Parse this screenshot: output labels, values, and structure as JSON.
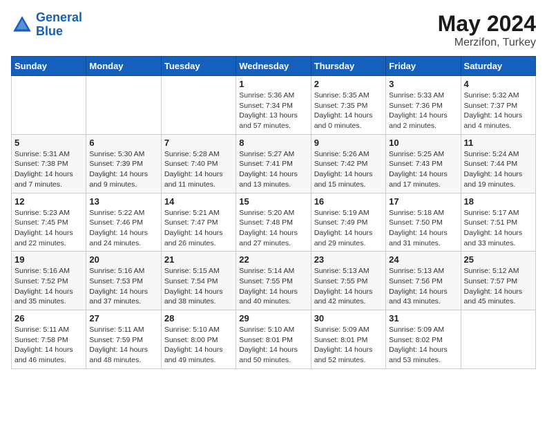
{
  "header": {
    "logo_line1": "General",
    "logo_line2": "Blue",
    "title": "May 2024",
    "subtitle": "Merzifon, Turkey"
  },
  "columns": [
    "Sunday",
    "Monday",
    "Tuesday",
    "Wednesday",
    "Thursday",
    "Friday",
    "Saturday"
  ],
  "weeks": [
    {
      "days": [
        {
          "num": "",
          "info": ""
        },
        {
          "num": "",
          "info": ""
        },
        {
          "num": "",
          "info": ""
        },
        {
          "num": "1",
          "info": "Sunrise: 5:36 AM\nSunset: 7:34 PM\nDaylight: 13 hours and 57 minutes."
        },
        {
          "num": "2",
          "info": "Sunrise: 5:35 AM\nSunset: 7:35 PM\nDaylight: 14 hours and 0 minutes."
        },
        {
          "num": "3",
          "info": "Sunrise: 5:33 AM\nSunset: 7:36 PM\nDaylight: 14 hours and 2 minutes."
        },
        {
          "num": "4",
          "info": "Sunrise: 5:32 AM\nSunset: 7:37 PM\nDaylight: 14 hours and 4 minutes."
        }
      ]
    },
    {
      "days": [
        {
          "num": "5",
          "info": "Sunrise: 5:31 AM\nSunset: 7:38 PM\nDaylight: 14 hours and 7 minutes."
        },
        {
          "num": "6",
          "info": "Sunrise: 5:30 AM\nSunset: 7:39 PM\nDaylight: 14 hours and 9 minutes."
        },
        {
          "num": "7",
          "info": "Sunrise: 5:28 AM\nSunset: 7:40 PM\nDaylight: 14 hours and 11 minutes."
        },
        {
          "num": "8",
          "info": "Sunrise: 5:27 AM\nSunset: 7:41 PM\nDaylight: 14 hours and 13 minutes."
        },
        {
          "num": "9",
          "info": "Sunrise: 5:26 AM\nSunset: 7:42 PM\nDaylight: 14 hours and 15 minutes."
        },
        {
          "num": "10",
          "info": "Sunrise: 5:25 AM\nSunset: 7:43 PM\nDaylight: 14 hours and 17 minutes."
        },
        {
          "num": "11",
          "info": "Sunrise: 5:24 AM\nSunset: 7:44 PM\nDaylight: 14 hours and 19 minutes."
        }
      ]
    },
    {
      "days": [
        {
          "num": "12",
          "info": "Sunrise: 5:23 AM\nSunset: 7:45 PM\nDaylight: 14 hours and 22 minutes."
        },
        {
          "num": "13",
          "info": "Sunrise: 5:22 AM\nSunset: 7:46 PM\nDaylight: 14 hours and 24 minutes."
        },
        {
          "num": "14",
          "info": "Sunrise: 5:21 AM\nSunset: 7:47 PM\nDaylight: 14 hours and 26 minutes."
        },
        {
          "num": "15",
          "info": "Sunrise: 5:20 AM\nSunset: 7:48 PM\nDaylight: 14 hours and 27 minutes."
        },
        {
          "num": "16",
          "info": "Sunrise: 5:19 AM\nSunset: 7:49 PM\nDaylight: 14 hours and 29 minutes."
        },
        {
          "num": "17",
          "info": "Sunrise: 5:18 AM\nSunset: 7:50 PM\nDaylight: 14 hours and 31 minutes."
        },
        {
          "num": "18",
          "info": "Sunrise: 5:17 AM\nSunset: 7:51 PM\nDaylight: 14 hours and 33 minutes."
        }
      ]
    },
    {
      "days": [
        {
          "num": "19",
          "info": "Sunrise: 5:16 AM\nSunset: 7:52 PM\nDaylight: 14 hours and 35 minutes."
        },
        {
          "num": "20",
          "info": "Sunrise: 5:16 AM\nSunset: 7:53 PM\nDaylight: 14 hours and 37 minutes."
        },
        {
          "num": "21",
          "info": "Sunrise: 5:15 AM\nSunset: 7:54 PM\nDaylight: 14 hours and 38 minutes."
        },
        {
          "num": "22",
          "info": "Sunrise: 5:14 AM\nSunset: 7:55 PM\nDaylight: 14 hours and 40 minutes."
        },
        {
          "num": "23",
          "info": "Sunrise: 5:13 AM\nSunset: 7:55 PM\nDaylight: 14 hours and 42 minutes."
        },
        {
          "num": "24",
          "info": "Sunrise: 5:13 AM\nSunset: 7:56 PM\nDaylight: 14 hours and 43 minutes."
        },
        {
          "num": "25",
          "info": "Sunrise: 5:12 AM\nSunset: 7:57 PM\nDaylight: 14 hours and 45 minutes."
        }
      ]
    },
    {
      "days": [
        {
          "num": "26",
          "info": "Sunrise: 5:11 AM\nSunset: 7:58 PM\nDaylight: 14 hours and 46 minutes."
        },
        {
          "num": "27",
          "info": "Sunrise: 5:11 AM\nSunset: 7:59 PM\nDaylight: 14 hours and 48 minutes."
        },
        {
          "num": "28",
          "info": "Sunrise: 5:10 AM\nSunset: 8:00 PM\nDaylight: 14 hours and 49 minutes."
        },
        {
          "num": "29",
          "info": "Sunrise: 5:10 AM\nSunset: 8:01 PM\nDaylight: 14 hours and 50 minutes."
        },
        {
          "num": "30",
          "info": "Sunrise: 5:09 AM\nSunset: 8:01 PM\nDaylight: 14 hours and 52 minutes."
        },
        {
          "num": "31",
          "info": "Sunrise: 5:09 AM\nSunset: 8:02 PM\nDaylight: 14 hours and 53 minutes."
        },
        {
          "num": "",
          "info": ""
        }
      ]
    }
  ]
}
